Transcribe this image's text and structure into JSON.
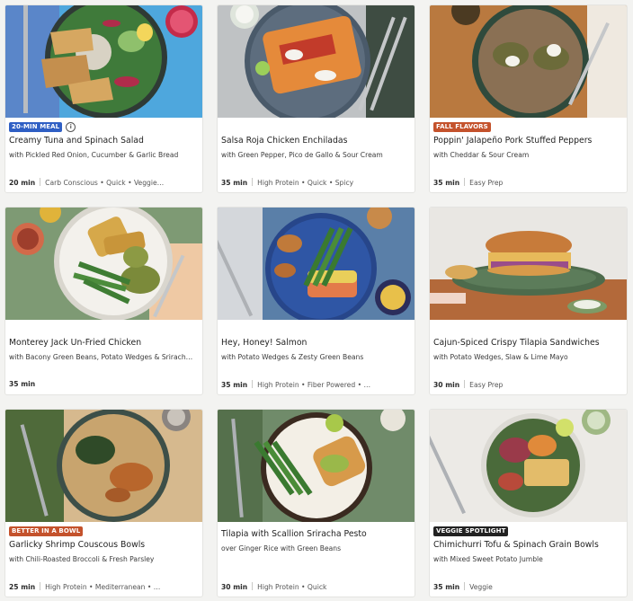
{
  "colors": {
    "badge_blue": "#2f5fc4",
    "badge_orange": "#c4522c",
    "badge_dark": "#222222"
  },
  "cards": [
    {
      "badge": "20-MIN MEAL",
      "badge_color": "#2f5fc4",
      "info_icon": "i",
      "title": "Creamy Tuna and Spinach Salad",
      "subtitle": "with Pickled Red Onion, Cucumber & Garlic Bread",
      "time": "20 min",
      "tags": "Carb Conscious • Quick • Veggie…",
      "image_icon": "tuna-salad-dish"
    },
    {
      "badge": "",
      "title": "Salsa Roja Chicken Enchiladas",
      "subtitle": "with Green Pepper, Pico de Gallo & Sour Cream",
      "time": "35 min",
      "tags": "High Protein • Quick • Spicy",
      "image_icon": "enchiladas-dish"
    },
    {
      "badge": "FALL FLAVORS",
      "badge_color": "#c4522c",
      "title": "Poppin' Jalapeño Pork Stuffed Peppers",
      "subtitle": "with Cheddar & Sour Cream",
      "time": "35 min",
      "tags": "Easy Prep",
      "image_icon": "stuffed-peppers-dish"
    },
    {
      "badge": "",
      "title": "Monterey Jack Un-Fried Chicken",
      "subtitle": "with Bacony Green Beans, Potato Wedges & Srirach…",
      "time": "35 min",
      "tags": "",
      "image_icon": "unfried-chicken-dish"
    },
    {
      "badge": "",
      "title": "Hey, Honey! Salmon",
      "subtitle": "with Potato Wedges & Zesty Green Beans",
      "time": "35 min",
      "tags": "High Protein • Fiber Powered • …",
      "image_icon": "salmon-dish"
    },
    {
      "badge": "",
      "title": "Cajun-Spiced Crispy Tilapia Sandwiches",
      "subtitle": "with Potato Wedges, Slaw & Lime Mayo",
      "time": "30 min",
      "tags": "Easy Prep",
      "image_icon": "tilapia-sandwich-dish"
    },
    {
      "badge": "BETTER IN A BOWL",
      "badge_color": "#c4522c",
      "title": "Garlicky Shrimp Couscous Bowls",
      "subtitle": "with Chili-Roasted Broccoli & Fresh Parsley",
      "time": "25 min",
      "tags": "High Protein • Mediterranean • …",
      "image_icon": "shrimp-couscous-dish"
    },
    {
      "badge": "",
      "title": "Tilapia with Scallion Sriracha Pesto",
      "subtitle": "over Ginger Rice with Green Beans",
      "time": "30 min",
      "tags": "High Protein • Quick",
      "image_icon": "tilapia-pesto-dish"
    },
    {
      "badge": "VEGGIE SPOTLIGHT",
      "badge_color": "#222222",
      "title": "Chimichurri Tofu & Spinach Grain Bowls",
      "subtitle": "with Mixed Sweet Potato Jumble",
      "time": "35 min",
      "tags": "Veggie",
      "image_icon": "tofu-grain-bowl-dish"
    }
  ]
}
